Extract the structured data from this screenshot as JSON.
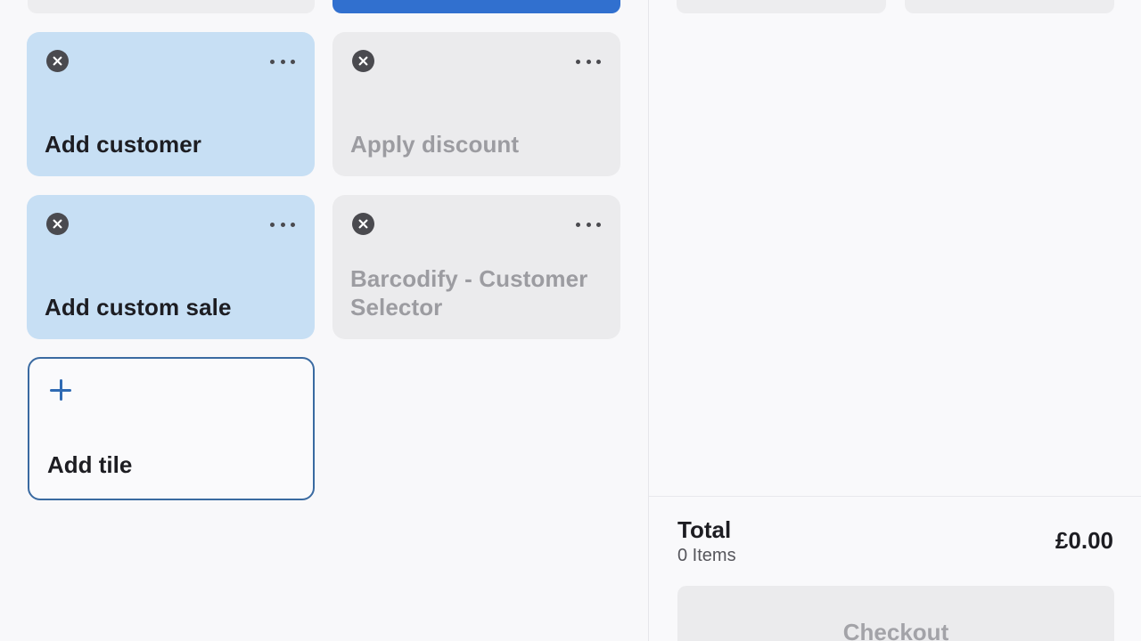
{
  "tiles": [
    {
      "label": "Add customer",
      "state": "enabled"
    },
    {
      "label": "Apply discount",
      "state": "disabled"
    },
    {
      "label": "Add custom sale",
      "state": "enabled"
    },
    {
      "label": "Barcodify - Customer Selector",
      "state": "disabled"
    }
  ],
  "add_tile": {
    "label": "Add tile",
    "icon": "plus-icon"
  },
  "tile_icons": {
    "remove": "close-circle-icon",
    "options": "more-horizontal-icon"
  },
  "cart": {
    "total_label": "Total",
    "items_count": "0 Items",
    "total_amount": "£0.00",
    "checkout_label": "Checkout"
  },
  "colors": {
    "tile_enabled": "#c7dff4",
    "tile_disabled": "#ebebed",
    "accent_blue": "#3170cf",
    "add_tile_border": "#3a6aa1"
  }
}
